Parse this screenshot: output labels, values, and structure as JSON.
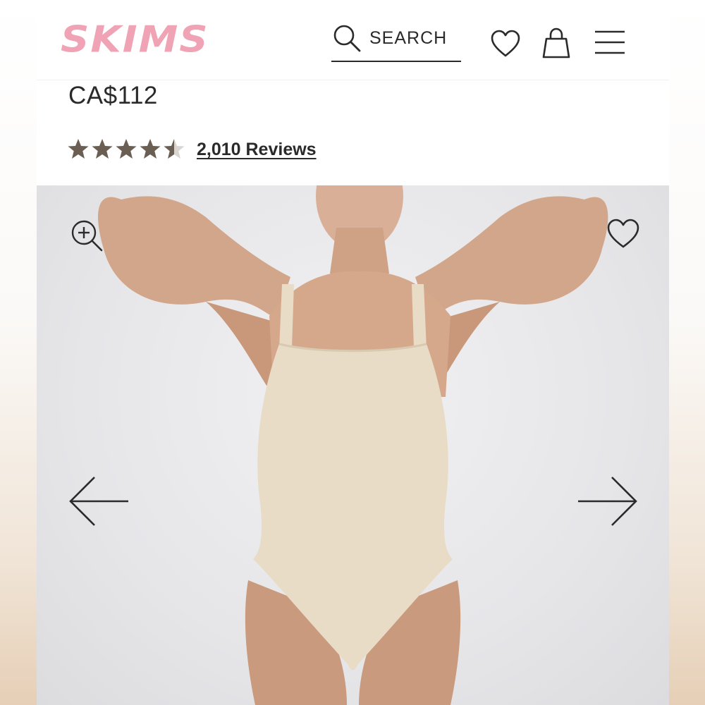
{
  "header": {
    "logo": "SKIMS",
    "search_label": "SEARCH",
    "icons": {
      "search": "search-icon",
      "wishlist": "heart-icon",
      "cart": "shopping-bag-icon",
      "menu": "hamburger-menu-icon"
    }
  },
  "product": {
    "price": "CA$112",
    "rating": 4.5,
    "rating_max": 5,
    "reviews_label": "2,010 Reviews"
  },
  "gallery": {
    "icons": {
      "zoom": "zoom-in-icon",
      "favorite": "heart-icon",
      "previous": "arrow-left-icon",
      "next": "arrow-right-icon"
    }
  },
  "colors": {
    "logo_pink": "#f0a3b4",
    "text_dark": "#2a2a2a",
    "star_brown": "#6b5e52",
    "bodysuit_beige": "#e8dcc7"
  }
}
